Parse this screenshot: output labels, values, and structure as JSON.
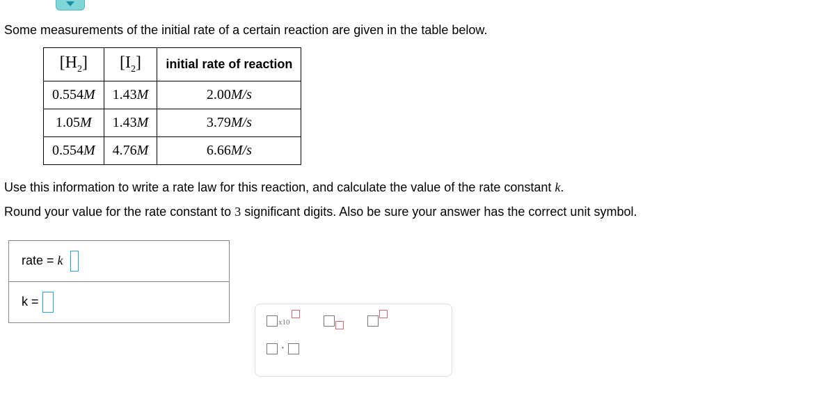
{
  "intro": "Some measurements of the initial rate of a certain reaction are given in the table below.",
  "table": {
    "headers": {
      "col1": "H",
      "col1_sub": "2",
      "col2": "I",
      "col2_sub": "2",
      "col3": "initial rate of reaction"
    },
    "rows": [
      {
        "h2": "0.554",
        "h2_unit": "M",
        "i2": "1.43",
        "i2_unit": "M",
        "rate": "2.00",
        "rate_unit": "M/s"
      },
      {
        "h2": "1.05",
        "h2_unit": "M",
        "i2": "1.43",
        "i2_unit": "M",
        "rate": "3.79",
        "rate_unit": "M/s"
      },
      {
        "h2": "0.554",
        "h2_unit": "M",
        "i2": "4.76",
        "i2_unit": "M",
        "rate": "6.66",
        "rate_unit": "M/s"
      }
    ]
  },
  "question1_a": "Use this information to write a rate law for this reaction, and calculate the value of the rate constant ",
  "question1_k": "k",
  "question1_b": ".",
  "question2_a": "Round your value for the rate constant to ",
  "question2_num": "3",
  "question2_b": " significant digits. Also be sure your answer has the correct unit symbol.",
  "answer": {
    "rate_label": "rate = ",
    "rate_k": "k",
    "k_label": "k = "
  },
  "palette": {
    "x10": "x10"
  }
}
